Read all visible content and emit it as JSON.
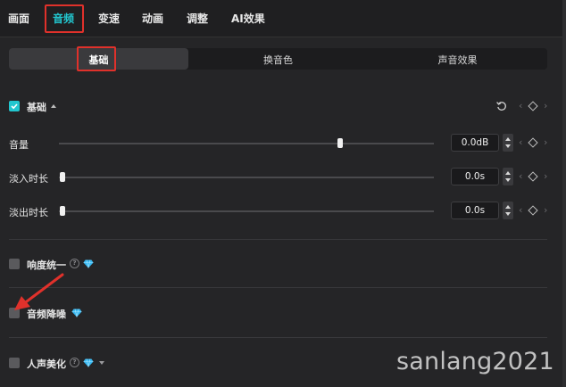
{
  "top_tabs": [
    {
      "label": "画面"
    },
    {
      "label": "音频"
    },
    {
      "label": "变速"
    },
    {
      "label": "动画"
    },
    {
      "label": "调整"
    },
    {
      "label": "AI效果"
    }
  ],
  "active_top_tab": "音频",
  "sub_tabs": [
    {
      "label": "基础"
    },
    {
      "label": "换音色"
    },
    {
      "label": "声音效果"
    }
  ],
  "active_sub_tab": "基础",
  "basic_section": {
    "label": "基础",
    "checked": true
  },
  "sliders": [
    {
      "label": "音量",
      "value": "0.0dB",
      "level": 0.75
    },
    {
      "label": "淡入时长",
      "value": "0.0s",
      "level": 0.0
    },
    {
      "label": "淡出时长",
      "value": "0.0s",
      "level": 0.0
    }
  ],
  "options": [
    {
      "label": "响度统一",
      "checked": false,
      "has_info": true,
      "has_vip": true,
      "has_dropdown": false
    },
    {
      "label": "音频降噪",
      "checked": false,
      "has_info": false,
      "has_vip": true,
      "has_dropdown": false
    },
    {
      "label": "人声美化",
      "checked": false,
      "has_info": true,
      "has_vip": true,
      "has_dropdown": true
    }
  ],
  "watermark": "sanlang2021",
  "colors": {
    "accent": "#22c6cf",
    "highlight_box": "#e0312b",
    "vip_gem": "#36b7f0",
    "annotation_arrow": "#e0312b"
  },
  "icons": {
    "reset": "reset-icon",
    "keyframe": "keyframe-diamond-icon",
    "vip": "vip-diamond-icon",
    "info": "info-icon"
  }
}
